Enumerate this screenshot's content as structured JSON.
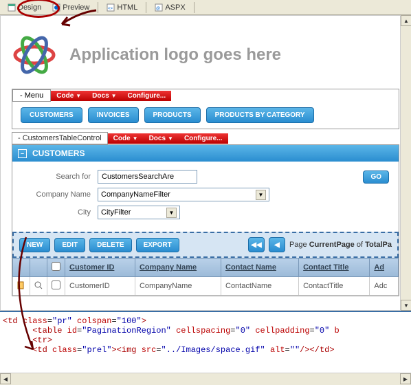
{
  "tabs": {
    "design": "Design",
    "preview": "Preview",
    "html": "HTML",
    "aspx": "ASPX"
  },
  "logo_text": "Application logo goes here",
  "menu": {
    "label": "- Menu",
    "code": "Code",
    "docs": "Docs",
    "configure": "Configure..."
  },
  "nav": {
    "customers": "CUSTOMERS",
    "invoices": "INVOICES",
    "products": "PRODUCTS",
    "products_by_category": "PRODUCTS BY CATEGORY"
  },
  "control": {
    "label": "- CustomersTableControl",
    "code": "Code",
    "docs": "Docs",
    "configure": "Configure..."
  },
  "panel": {
    "title": "CUSTOMERS",
    "search_for": "Search for",
    "search_value": "CustomersSearchAre",
    "go": "GO",
    "company_name": "Company Name",
    "company_filter": "CompanyNameFilter",
    "city": "City",
    "city_filter": "CityFilter"
  },
  "toolbar": {
    "new": "NEW",
    "edit": "EDIT",
    "delete": "DELETE",
    "export": "EXPORT",
    "page": "Page",
    "current_page": "CurrentPage",
    "of": "of",
    "total": "TotalPa"
  },
  "grid": {
    "headers": [
      "Customer ID",
      "Company Name",
      "Contact Name",
      "Contact Title",
      "Ad"
    ],
    "row": [
      "CustomerID",
      "CompanyName",
      "ContactName",
      "ContactTitle",
      "Adc"
    ]
  },
  "code": {
    "line1_a": "<td",
    "line1_b": "class",
    "line1_c": "\"pr\"",
    "line1_d": "colspan",
    "line1_e": "\"100\"",
    "line1_f": ">",
    "line2_a": "<table",
    "line2_b": "id",
    "line2_c": "\"PaginationRegion\"",
    "line2_d": "cellspacing",
    "line2_e": "\"0\"",
    "line2_f": "cellpadding",
    "line2_g": "\"0\"",
    "line2_h": "b",
    "line3": "<tr>",
    "line4_a": "<td",
    "line4_b": "class",
    "line4_c": "\"prel\"",
    "line4_d": "><img",
    "line4_e": "src",
    "line4_f": "\"../Images/space.gif\"",
    "line4_g": "alt",
    "line4_h": "\"\"",
    "line4_i": "/></td>"
  }
}
